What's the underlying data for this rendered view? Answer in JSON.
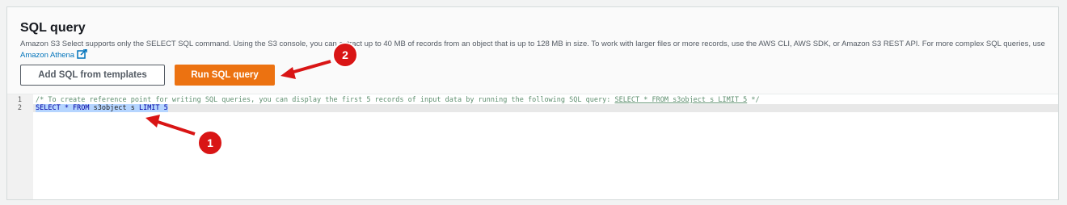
{
  "panel": {
    "title": "SQL query",
    "description_before_link": "Amazon S3 Select supports only the SELECT SQL command. Using the S3 console, you can extract up to 40 MB of records from an object that is up to 128 MB in size. To work with larger files or more records, use the AWS CLI, AWS SDK, or Amazon S3 REST API. For more complex SQL queries, use ",
    "link_text": "Amazon Athena",
    "link_icon": "external-link-icon"
  },
  "buttons": {
    "templates_label": "Add SQL from templates",
    "run_label": "Run SQL query"
  },
  "editor": {
    "line_numbers": [
      "1",
      "2"
    ],
    "line1_comment_prefix": "/* To create reference point for writing SQL queries, you can display the first 5 records of input data by running the following SQL query: ",
    "line1_highlight": "SELECT * FROM s3object s LIMIT 5",
    "line1_suffix": " */",
    "line2_keyword1": "SELECT * FROM",
    "line2_middle": " s3object s ",
    "line2_keyword2": "LIMIT 5"
  },
  "annotations": {
    "marker1": "1",
    "marker2": "2",
    "color": "#d91515"
  }
}
